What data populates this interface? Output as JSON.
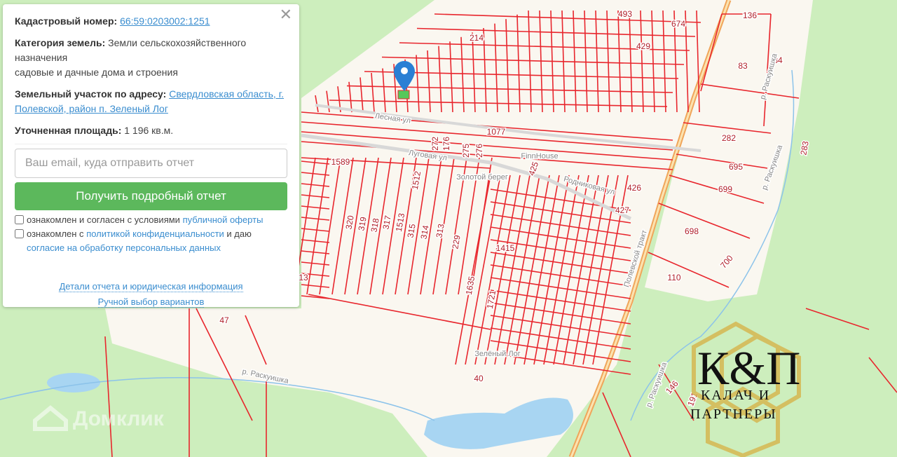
{
  "panel": {
    "close_icon": "close-icon",
    "cadastral_label": "Кадастровый номер:",
    "cadastral_value": "66:59:0203002:1251",
    "category_label": "Категория земель:",
    "category_value": "Земли сельскохозяйственного назначения",
    "category_use": "садовые и дачные дома и строения",
    "address_label": "Земельный участок по адресу:",
    "address_value": "Свердловская область, г. Полевской, район п. Зеленый Лог",
    "area_label": "Уточненная площадь:",
    "area_value": "1 196 кв.м.",
    "email_placeholder": "Ваш email, куда отправить отчет",
    "get_report": "Получить подробный отчет",
    "check1_text": "ознакомлен и согласен с условиями",
    "check1_link": "публичной оферты",
    "check2_text": "ознакомлен с",
    "check2_link": "политикой конфиденциальности",
    "check2_mid": "и даю",
    "check2_link2": "согласие на обработку персональных данных",
    "details_link": "Детали отчета и юридическая информация",
    "manual_link": "Ручной выбор вариантов"
  },
  "map": {
    "parcel_labels": [
      "493",
      "136",
      "674",
      "214",
      "429",
      "83",
      "84",
      "1077",
      "272",
      "176",
      "275",
      "276",
      "1589",
      "425",
      "282",
      "695",
      "283",
      "699",
      "426",
      "427",
      "698",
      "1512",
      "320",
      "319",
      "318",
      "317",
      "1513",
      "315",
      "314",
      "313",
      "229",
      "1415",
      "1635",
      "1721",
      "700",
      "110",
      "47",
      "40",
      "146",
      "191",
      "13"
    ],
    "streets": [
      "Лесная ул",
      "Луговая ул",
      "Родниковая ул",
      "Полевской тракт"
    ],
    "places": [
      "Золотой берег",
      "Зелёный Лог",
      "FinnHouse"
    ],
    "rivers": [
      "р. Раскуишка",
      "р. Раскуишка",
      "р. Раскуишка",
      "р. Раскуишка"
    ],
    "marker_icon": "map-pin-icon",
    "colors": {
      "parcel": "#e8262d",
      "land": "#cdeebd",
      "settlement": "#faf7f0",
      "water": "#a8d5f2",
      "marker": "#2a7fd4"
    }
  },
  "watermark": {
    "text": "Домклик"
  },
  "logo": {
    "monogram": "К&П",
    "line1": "КАЛАЧ И",
    "line2": "ПАРТНЕРЫ"
  }
}
